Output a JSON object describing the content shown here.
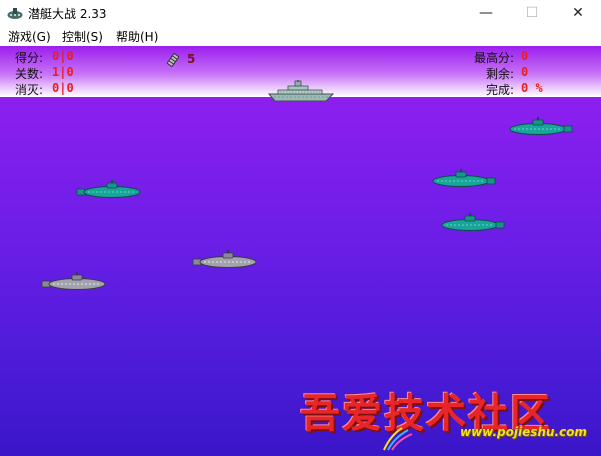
{
  "window": {
    "title": "潜艇大战 2.33",
    "minimize_glyph": "—",
    "maximize_glyph": "☐",
    "close_glyph": "✕",
    "icon": "submarine-app-icon"
  },
  "menu": {
    "items": [
      "游戏(G)",
      "控制(S)",
      "帮助(H)"
    ]
  },
  "hud": {
    "score_label": "得分:",
    "score_value": "0|0",
    "level_label": "关数:",
    "level_value": "1|0",
    "destroyed_label": "消灭:",
    "destroyed_value": "0|0",
    "ammo_count": "5",
    "high_score_label": "最高分:",
    "high_score_value": "0",
    "remaining_label": "剩余:",
    "remaining_value": "0",
    "completion_label": "完成:",
    "completion_value": "0 %"
  },
  "colors": {
    "hud_value": "#e5201f",
    "sky_top": "#9a1fee",
    "sea_bottom": "#3a16c8",
    "teal_sub": "#1aa59a",
    "grey_sub": "#9a9aa6"
  },
  "watermark": {
    "text": "吾爱技术社区",
    "url": "www.pojieshu.com"
  }
}
